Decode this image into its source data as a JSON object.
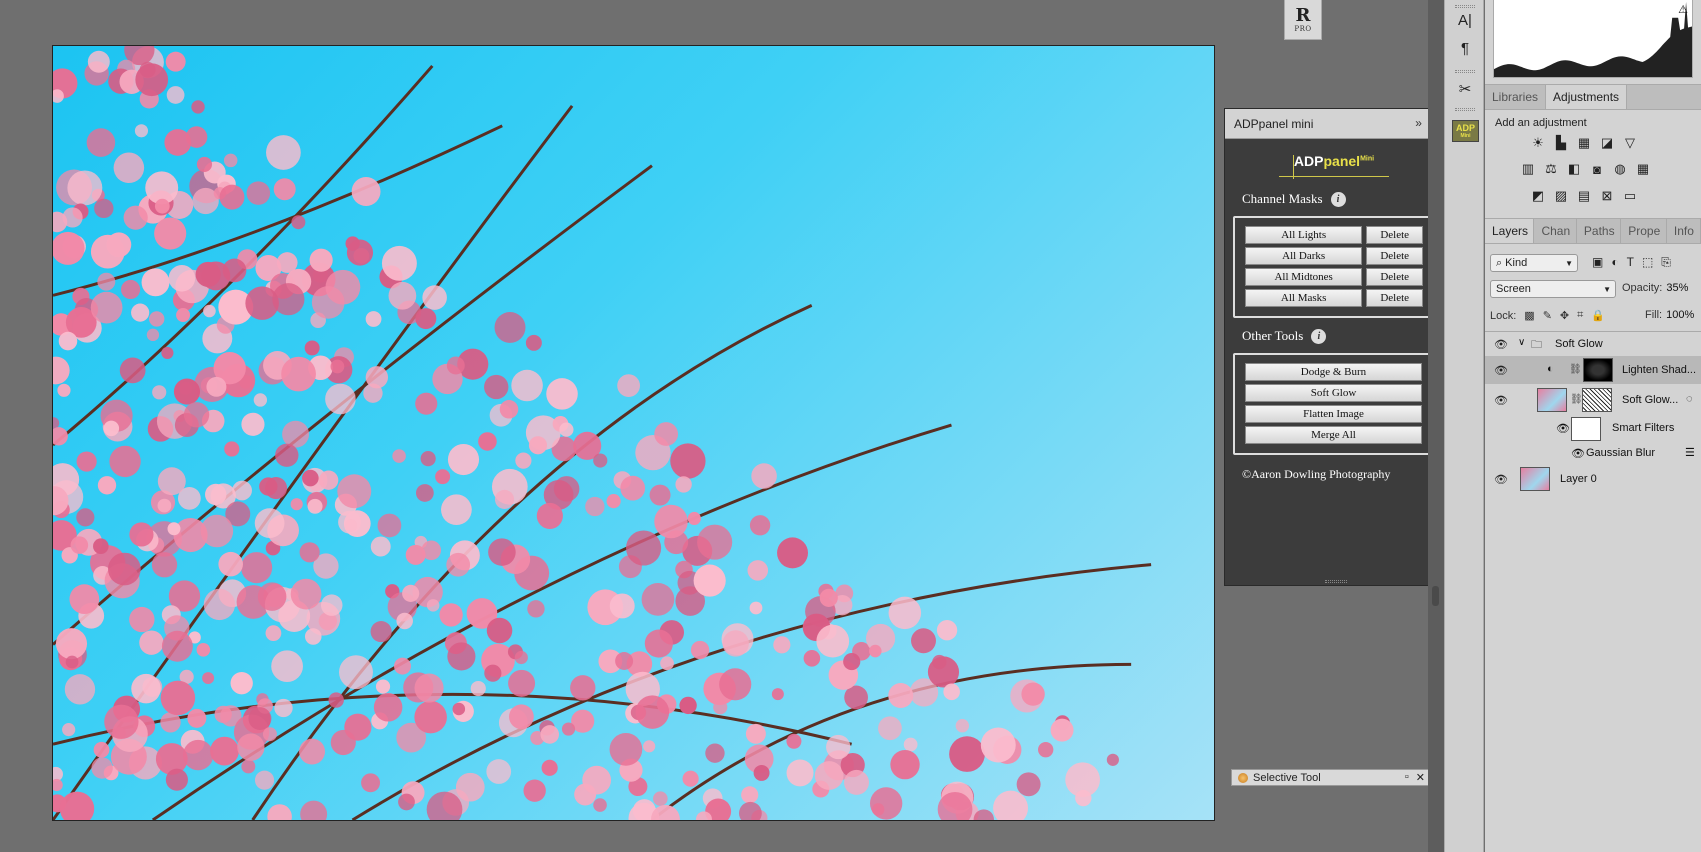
{
  "canvas": {
    "alt": "Pink tabebuia blossoms against blue sky"
  },
  "rpro": {
    "letter": "R",
    "sub": "PRO"
  },
  "adp_panel": {
    "title": "ADPpanel mini",
    "logo_main": "ADP",
    "logo_panel": "panel",
    "logo_mini": "Mini",
    "channel_masks_heading": "Channel Masks",
    "info_glyph": "i",
    "channel_masks": [
      {
        "label": "All Lights",
        "delete": "Delete"
      },
      {
        "label": "All Darks",
        "delete": "Delete"
      },
      {
        "label": "All Midtones",
        "delete": "Delete"
      },
      {
        "label": "All Masks",
        "delete": "Delete"
      }
    ],
    "other_tools_heading": "Other Tools",
    "other_tools": [
      "Dodge & Burn",
      "Soft Glow",
      "Flatten Image",
      "Merge All"
    ],
    "credit": "©Aaron Dowling Photography",
    "ctrl_expand": "»",
    "ctrl_menu": "≡"
  },
  "selective_tool": {
    "title": "Selective Tool"
  },
  "tool_column": {
    "adp_label": "ADP",
    "adp_sub": "Mini"
  },
  "right_panel": {
    "hist_warning": "⚠",
    "top_tabs": [
      "Libraries",
      "Adjustments"
    ],
    "adjust_title": "Add an adjustment",
    "layer_tabs": [
      "Layers",
      "Chan",
      "Paths",
      "Prope",
      "Info"
    ],
    "kind_label": "Kind",
    "blend_mode": "Screen",
    "opacity_label": "Opacity:",
    "opacity_value": "35%",
    "lock_label": "Lock:",
    "fill_label": "Fill:",
    "fill_value": "100%",
    "layers": [
      {
        "name": "Soft Glow"
      },
      {
        "name": "Lighten Shad..."
      },
      {
        "name": "Soft Glow..."
      },
      {
        "name": "Smart Filters"
      },
      {
        "name": "Gaussian Blur"
      },
      {
        "name": "Layer 0"
      }
    ]
  }
}
